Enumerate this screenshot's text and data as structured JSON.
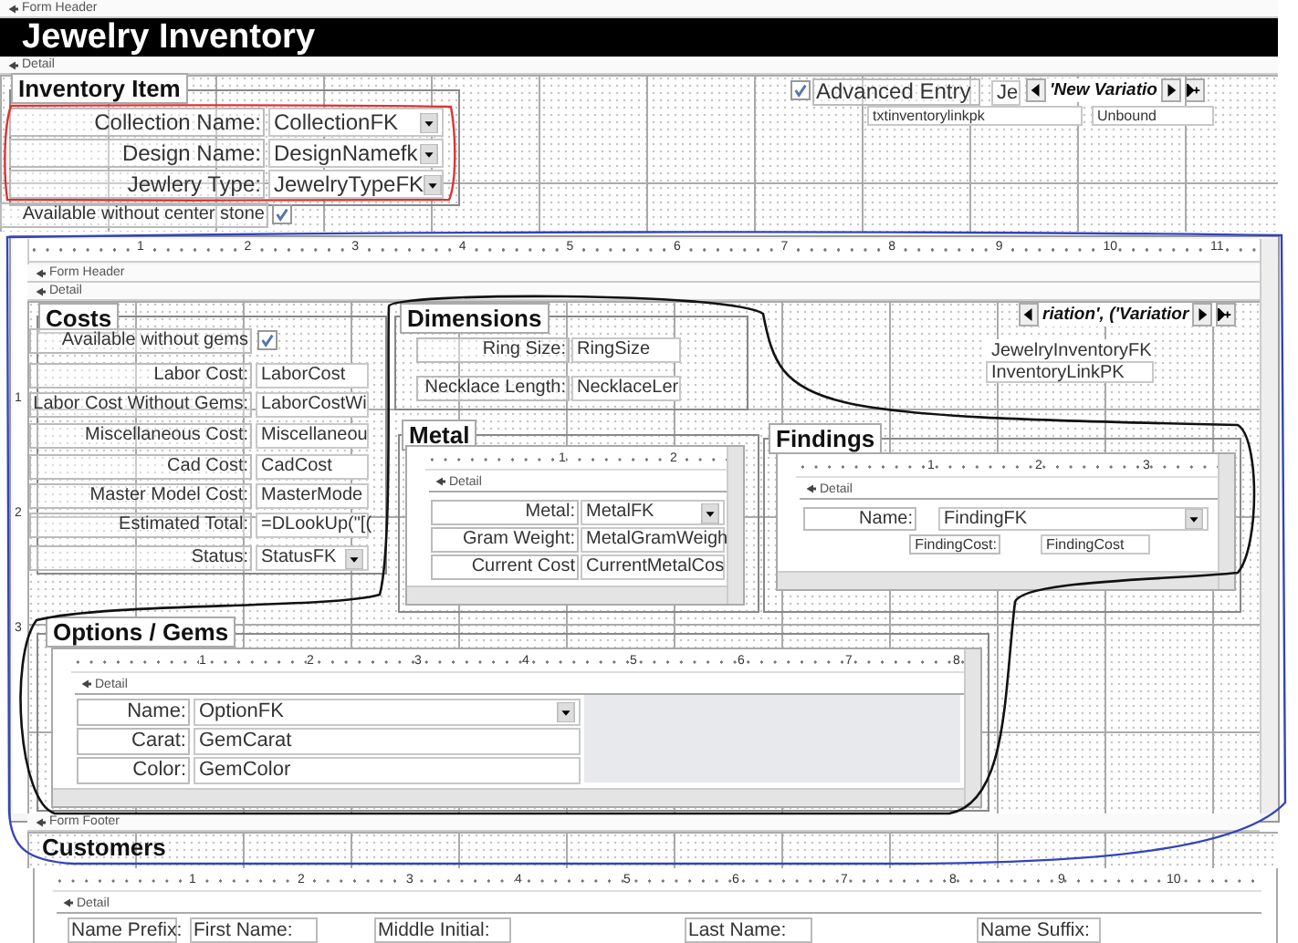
{
  "form_header": "Form Header",
  "title": "Jewelry Inventory",
  "detail_bar": "Detail",
  "inventory_item": {
    "title": "Inventory Item",
    "fields": [
      {
        "label": "Collection Name:",
        "value": "CollectionFK",
        "kind": "combo"
      },
      {
        "label": "Design Name:",
        "value": "DesignNamefk",
        "kind": "combo"
      },
      {
        "label": "Jewlery Type:",
        "value": "JewelryTypeFK",
        "kind": "combo"
      }
    ],
    "checkbox": {
      "label": "Available without center stone",
      "checked": true
    }
  },
  "advanced_entry": {
    "label": "Advanced Entry",
    "checked": true
  },
  "je_box": "Je",
  "top_navigator": {
    "caption": "'New Variatio"
  },
  "link_fields": [
    "txtinventorylinkpk",
    "Unbound"
  ],
  "subform": {
    "ruler": [
      "1",
      "2",
      "3",
      "4",
      "5",
      "6",
      "7",
      "8",
      "9",
      "10",
      "11"
    ],
    "vertical_ruler": [
      "1",
      "2",
      "3"
    ],
    "header_bar": "Form Header",
    "detail_bar": "Detail",
    "costs": {
      "title": "Costs",
      "checkbox": {
        "label": "Available without gems",
        "checked": true
      },
      "fields": [
        {
          "label": "Labor Cost:",
          "value": "LaborCost",
          "kind": "text"
        },
        {
          "label": "Labor Cost Without Gems:",
          "value": "LaborCostWi",
          "kind": "text"
        },
        {
          "label": "Miscellaneous Cost:",
          "value": "Miscellaneou",
          "kind": "text"
        },
        {
          "label": "Cad Cost:",
          "value": "CadCost",
          "kind": "text"
        },
        {
          "label": "Master Model Cost:",
          "value": "MasterMode",
          "kind": "text"
        },
        {
          "label": "Estimated Total:",
          "value": "=DLookUp(\"[(",
          "kind": "text"
        },
        {
          "label": "Status:",
          "value": "StatusFK",
          "kind": "combo"
        }
      ]
    },
    "dimensions": {
      "title": "Dimensions",
      "fields": [
        {
          "label": "Ring Size:",
          "value": "RingSize",
          "kind": "text"
        },
        {
          "label": "Necklace Length:",
          "value": "NecklaceLer",
          "kind": "text"
        }
      ]
    },
    "navigator": {
      "caption": "riation', ('Variatior"
    },
    "link_fields": [
      "JewelryInventoryFK",
      "InventoryLinkPK"
    ],
    "metal": {
      "title": "Metal",
      "ruler": [
        "1",
        "2"
      ],
      "detail_bar": "Detail",
      "fields": [
        {
          "label": "Metal:",
          "value": "MetalFK",
          "kind": "combo"
        },
        {
          "label": "Gram Weight:",
          "value": "MetalGramWeigh",
          "kind": "text"
        },
        {
          "label": "Current Cost",
          "value": "CurrentMetalCos",
          "kind": "text"
        }
      ]
    },
    "findings": {
      "title": "Findings",
      "ruler": [
        "1",
        "2",
        "3"
      ],
      "detail_bar": "Detail",
      "fields": [
        {
          "label": "Name:",
          "value": "FindingFK",
          "kind": "combo"
        },
        {
          "label": "FindingCost:",
          "value": "FindingCost",
          "kind": "text"
        }
      ]
    },
    "options_gems": {
      "title": "Options / Gems",
      "ruler": [
        "1",
        "2",
        "3",
        "4",
        "5",
        "6",
        "7",
        "8"
      ],
      "detail_bar": "Detail",
      "fields": [
        {
          "label": "Name:",
          "value": "OptionFK",
          "kind": "combo"
        },
        {
          "label": "Carat:",
          "value": "GemCarat",
          "kind": "text"
        },
        {
          "label": "Color:",
          "value": "GemColor",
          "kind": "text"
        }
      ]
    },
    "footer_bar": "Form Footer"
  },
  "customers": {
    "title": "Customers",
    "ruler": [
      "1",
      "2",
      "3",
      "4",
      "5",
      "6",
      "7",
      "8",
      "9",
      "10"
    ],
    "detail_bar": "Detail",
    "labels": [
      "Name Prefix:",
      "First Name:",
      "Middle Initial:",
      "Last Name:",
      "Name Suffix:"
    ]
  }
}
